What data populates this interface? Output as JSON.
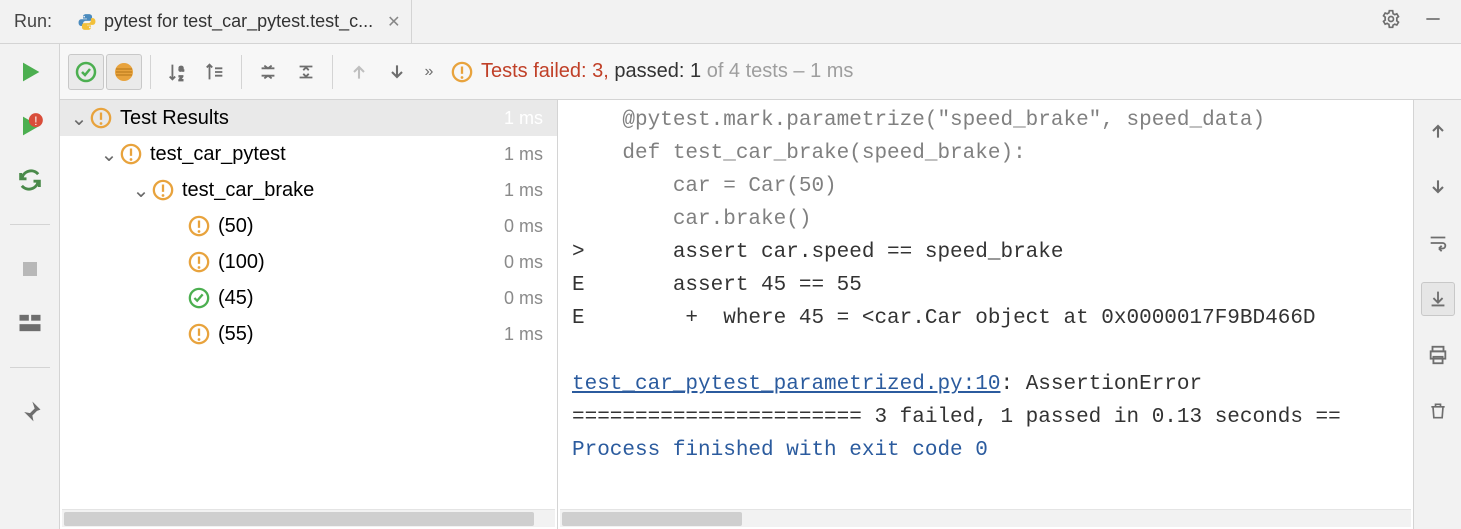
{
  "header": {
    "run_label": "Run:",
    "tab_title": "pytest for test_car_pytest.test_c..."
  },
  "summary": {
    "failed_label": "Tests failed: 3,",
    "passed_label": " passed: 1",
    "of_label": " of 4 tests – 1 ms"
  },
  "tree": {
    "root": {
      "label": "Test Results",
      "time": "1 ms"
    },
    "module": {
      "label": "test_car_pytest",
      "time": "1 ms"
    },
    "func": {
      "label": "test_car_brake",
      "time": "1 ms"
    },
    "cases": [
      {
        "label": "(50)",
        "time": "0 ms",
        "status": "warn"
      },
      {
        "label": "(100)",
        "time": "0 ms",
        "status": "warn"
      },
      {
        "label": "(45)",
        "time": "0 ms",
        "status": "pass"
      },
      {
        "label": "(55)",
        "time": "1 ms",
        "status": "warn"
      }
    ]
  },
  "console": {
    "l1": "    @pytest.mark.parametrize(\"speed_brake\", speed_data)",
    "l2": "    def test_car_brake(speed_brake):",
    "l3": "        car = Car(50)",
    "l4": "        car.brake()",
    "l5": ">       assert car.speed == speed_brake",
    "l6": "E       assert 45 == 55",
    "l7": "E        +  where 45 = <car.Car object at 0x0000017F9BD466D",
    "l8": "",
    "link": "test_car_pytest_parametrized.py:10",
    "err": ": AssertionError",
    "sep": "======================= 3 failed, 1 passed in 0.13 seconds ==",
    "exit": "Process finished with exit code 0"
  }
}
